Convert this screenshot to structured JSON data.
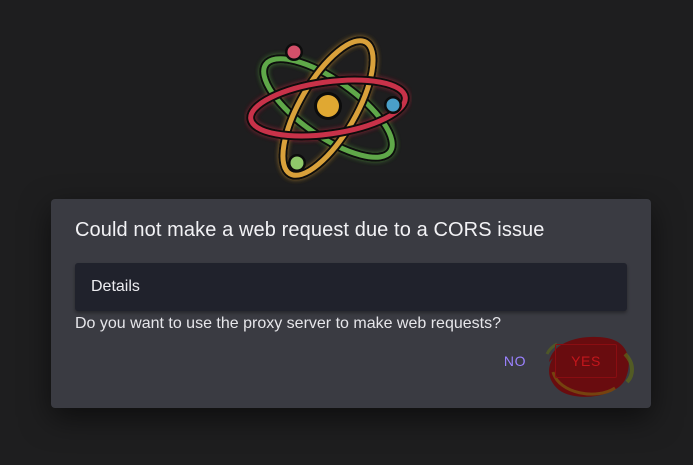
{
  "logo": {
    "icon": "atom-icon"
  },
  "dialog": {
    "title": "Could not make a web request due to a CORS issue",
    "details_label": "Details",
    "question": "Do you want to use the proxy server to make web requests?",
    "no_label": "NO",
    "yes_label": "YES"
  },
  "colors": {
    "background": "#1e1e1f",
    "dialog": "#3a3b42",
    "details_panel": "#20222c",
    "no_button": "#9b82ff",
    "yes_button": "#c4161c",
    "scribble": "#7a0a0e"
  }
}
